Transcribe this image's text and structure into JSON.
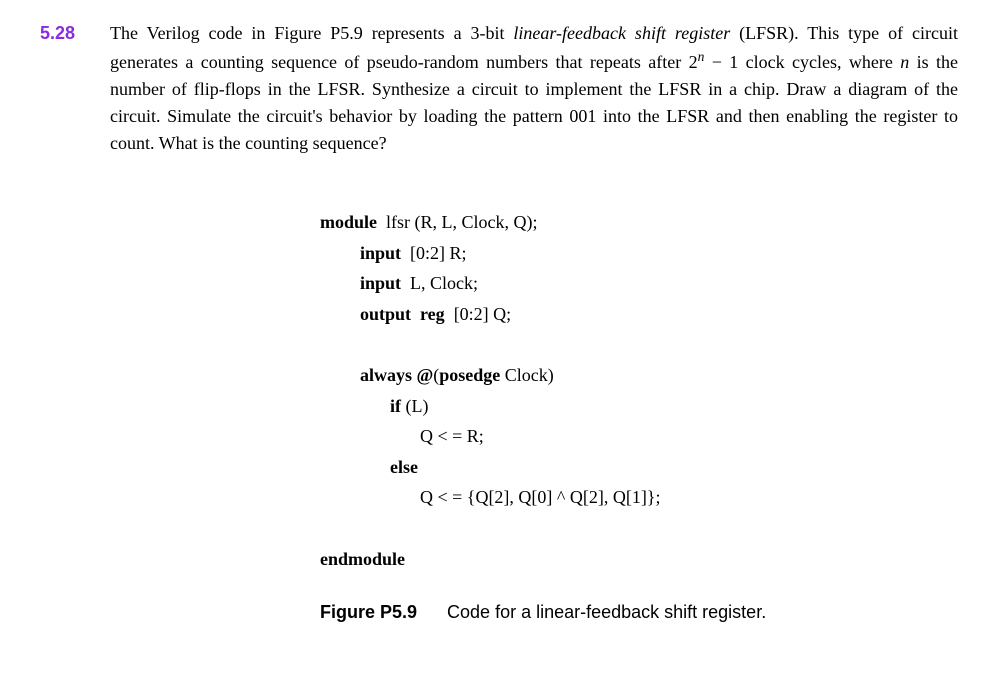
{
  "problem": {
    "number": "5.28",
    "text_parts": {
      "p1": "The Verilog code in Figure P5.9 represents a 3-bit ",
      "p2_italic": "linear-feedback shift register",
      "p3": " (LFSR). This type of circuit generates a counting sequence of pseudo-random numbers that repeats after 2",
      "p4_sup": "n",
      "p5": " − 1 clock cycles, where ",
      "p6_italic": "n",
      "p7": " is the number of flip-flops in the LFSR. Synthesize a circuit to implement the LFSR in a chip.  Draw a diagram of the circuit.  Simulate the circuit's behavior by loading the pattern 001 into the LFSR and then enabling the register to count. What is the counting sequence?"
    }
  },
  "code": {
    "l1_kw": "module",
    "l1_rest": "  lfsr (R, L, Clock, Q);",
    "l2_kw": "input",
    "l2_rest": "  [0:2] R;",
    "l3_kw": "input",
    "l3_rest": "  L, Clock;",
    "l4_kw": "output  reg",
    "l4_rest": "  [0:2] Q;",
    "l5_kw": "always @",
    "l5_rest1": "(",
    "l5_kw2": "posedge",
    "l5_rest2": " Clock)",
    "l6_kw": "if",
    "l6_rest": " (L)",
    "l7": "Q < = R;",
    "l8_kw": "else",
    "l9": "Q < = {Q[2], Q[0] ^ Q[2], Q[1]};",
    "l10_kw": "endmodule"
  },
  "figure": {
    "label": "Figure P5.9",
    "description": "Code for a linear-feedback shift register."
  }
}
